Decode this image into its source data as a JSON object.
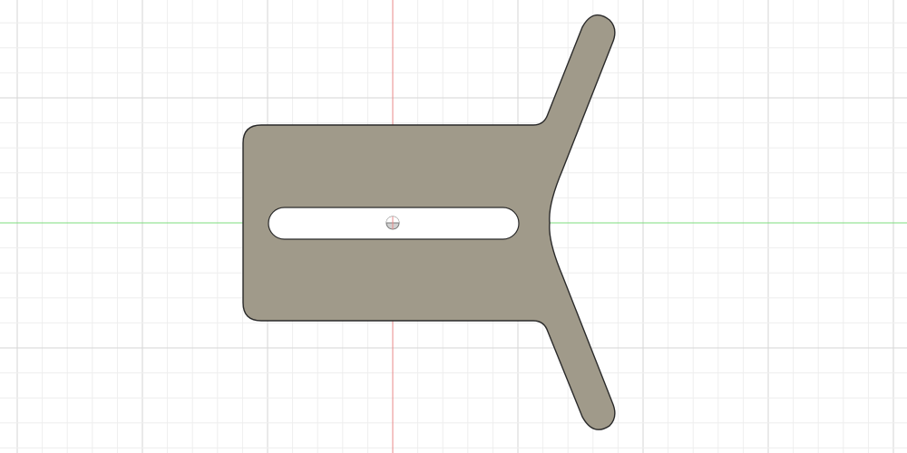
{
  "app": {
    "view": "sketch-canvas-top-view"
  },
  "grid": {
    "visible": true,
    "minor_color": "#eeeeee",
    "major_color": "#d6d6d6"
  },
  "axes": {
    "x_axis_color": "#7ddc7d",
    "y_axis_color": "#e88a8a"
  },
  "part": {
    "name": "y-bracket-plate",
    "fill_color": "#a09a8a",
    "outline_color": "#2a2a2a",
    "features": {
      "slot": "center-slot",
      "origin_marker": "origin-icon"
    }
  }
}
